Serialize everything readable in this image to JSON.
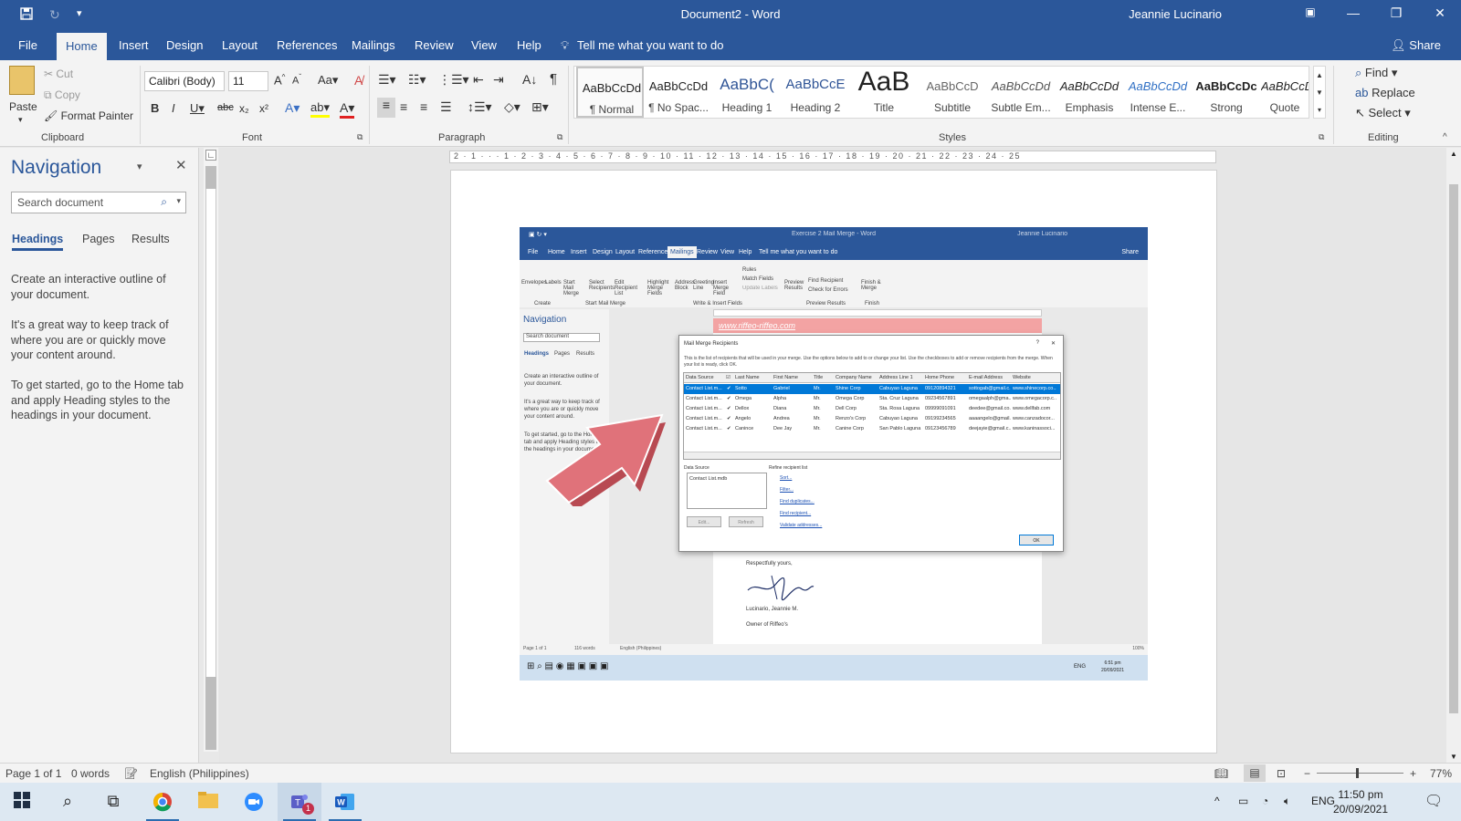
{
  "window": {
    "doc_title": "Document2 - Word",
    "user": "Jeannie Lucinario",
    "tell_me": "Tell me what you want to do",
    "share": "Share"
  },
  "menu": {
    "tabs": [
      "File",
      "Home",
      "Insert",
      "Design",
      "Layout",
      "References",
      "Mailings",
      "Review",
      "View",
      "Help"
    ]
  },
  "ribbon": {
    "clipboard": {
      "paste": "Paste",
      "cut": "Cut",
      "copy": "Copy",
      "format_painter": "Format Painter",
      "label": "Clipboard"
    },
    "font": {
      "name": "Calibri (Body)",
      "size": "11",
      "label": "Font",
      "change_case": "Aa"
    },
    "paragraph": {
      "label": "Paragraph"
    },
    "styles": {
      "label": "Styles",
      "items": [
        {
          "preview": "AaBbCcDd",
          "name": "¶ Normal"
        },
        {
          "preview": "AaBbCcDd",
          "name": "¶ No Spac..."
        },
        {
          "preview": "AaBbC(",
          "name": "Heading 1"
        },
        {
          "preview": "AaBbCcE",
          "name": "Heading 2"
        },
        {
          "preview": "AaB",
          "name": "Title"
        },
        {
          "preview": "AaBbCcD",
          "name": "Subtitle"
        },
        {
          "preview": "AaBbCcDd",
          "name": "Subtle Em..."
        },
        {
          "preview": "AaBbCcDd",
          "name": "Emphasis"
        },
        {
          "preview": "AaBbCcDd",
          "name": "Intense E..."
        },
        {
          "preview": "AaBbCcDc",
          "name": "Strong"
        },
        {
          "preview": "AaBbCcDd",
          "name": "Quote"
        }
      ]
    },
    "editing": {
      "find": "Find",
      "replace": "Replace",
      "select": "Select",
      "label": "Editing"
    }
  },
  "navigation": {
    "title": "Navigation",
    "search_placeholder": "Search document",
    "tabs": [
      "Headings",
      "Pages",
      "Results"
    ],
    "paragraphs": [
      "Create an interactive outline of your document.",
      "It's a great way to keep track of where you are or quickly move your content around.",
      "To get started, go to the Home tab and apply Heading styles to the headings in your document."
    ]
  },
  "ruler": {
    "text": "2 · 1 · · · 1 · 2 · 3 · 4 · 5 · 6 · 7 · 8 · 9 · 10 · 11 · 12 · 13 · 14 · 15 · 16 · 17 · 18 · 19 · 20 · 21 · 22 · 23 · 24 · 25"
  },
  "embedded": {
    "title": "Exercise 2 Mail Merge - Word",
    "user": "Jeannie Lucinario",
    "tabs": [
      "File",
      "Home",
      "Insert",
      "Design",
      "Layout",
      "References",
      "Mailings",
      "Review",
      "View",
      "Help"
    ],
    "tell_me": "Tell me what you want to do",
    "share": "Share",
    "ribbon_buttons": [
      "Envelopes",
      "Labels",
      "Start Mail Merge",
      "Select Recipients",
      "Edit Recipient List",
      "Highlight Merge Fields",
      "Address Block",
      "Greeting Line",
      "Insert Merge Field",
      "Preview Results",
      "Finish & Merge"
    ],
    "ribbon_small": [
      "Rules",
      "Match Fields",
      "Update Labels",
      "Find Recipient",
      "Check for Errors"
    ],
    "ribbon_groups": [
      "Create",
      "Start Mail Merge",
      "Write & Insert Fields",
      "Preview Results",
      "Finish"
    ],
    "nav_title": "Navigation",
    "nav_search": "Search document",
    "nav_tabs": [
      "Headings",
      "Pages",
      "Results"
    ],
    "nav_text": [
      "Create an interactive outline of your document.",
      "It's a great way to keep track of where you are or quickly move your content around.",
      "To get started, go to the Home tab and apply Heading styles to the headings in your document."
    ],
    "banner": "www.riffeo-riffeo.com",
    "dialog": {
      "title": "Mail Merge Recipients",
      "info": "This is the list of recipients that will be used in your merge. Use the options below to add to or change your list. Use the checkboxes to add or remove recipients from the merge. When your list is ready, click OK.",
      "columns": [
        "Data Source",
        "",
        "Last Name",
        "First Name",
        "Title",
        "Company Name",
        "Address Line 1",
        "Home Phone",
        "E-mail Address",
        "Website"
      ],
      "rows": [
        [
          "Contact List.m...",
          "✔",
          "Sotto",
          "Gabriel",
          "Mr.",
          "Shine Corp",
          "Cabuyao Laguna",
          "09120894321",
          "sottogab@gmail.c...",
          "www.shinecorp.co..."
        ],
        [
          "Contact List.m...",
          "✔",
          "Omega",
          "Alpha",
          "Mr.",
          "Omega Corp",
          "Sta. Cruz Laguna",
          "09234567891",
          "omegaalph@gma...",
          "www.omegacorp.c..."
        ],
        [
          "Contact List.m...",
          "✔",
          "Dellox",
          "Diana",
          "Mr.",
          "Dell Corp",
          "Sta. Rosa Laguna",
          "09999091091",
          "deedee@gmail.co...",
          "www.dellfab.com"
        ],
        [
          "Contact List.m...",
          "✔",
          "Angelo",
          "Andrea",
          "Mr.",
          "Renzo's Corp",
          "Cabuyao Laguna",
          "09199234565",
          "aaaangelo@gmail...",
          "www.canzadocor..."
        ],
        [
          "Contact List.m...",
          "✔",
          "Canince",
          "Dee Jay",
          "Mr.",
          "Canine Corp",
          "San Pablo Laguna",
          "09123456789",
          "deejayie@gmail.c...",
          "www.kaninassoci..."
        ]
      ],
      "data_source_label": "Data Source",
      "data_source_item": "Contact List.mdb",
      "edit": "Edit...",
      "refresh": "Refresh",
      "refine_label": "Refine recipient list",
      "refine_links": [
        "Sort...",
        "Filter...",
        "Find duplicates...",
        "Find recipient...",
        "Validate addresses..."
      ],
      "ok": "OK"
    },
    "closing": "Respectfully yours,",
    "signer": "Lucinario, Jeannie M.",
    "signer_title": "Owner of Riffeo's",
    "status": [
      "Page 1 of 1",
      "116 words",
      "English (Philippines)"
    ],
    "clock": [
      "6:51 pm",
      "20/09/2021"
    ],
    "tray_lang": "ENG",
    "zoom": "100%"
  },
  "status": {
    "page": "Page 1 of 1",
    "words": "0 words",
    "language": "English (Philippines)",
    "zoom": "77%",
    "zoom_fraction": 0.46
  },
  "taskbar": {
    "lang": "ENG",
    "time": "11:50 pm",
    "date": "20/09/2021",
    "teams_badge": "1"
  },
  "colors": {
    "accent": "#2b579a",
    "arrow": "#e0727a",
    "highlight_row": "#0078d7"
  }
}
